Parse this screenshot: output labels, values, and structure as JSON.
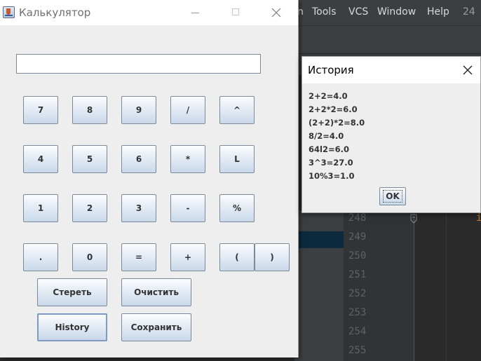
{
  "ide": {
    "menu_items": [
      "n",
      "Tools",
      "VCS",
      "Window",
      "Help",
      "24"
    ],
    "line_numbers": [
      "248",
      "249",
      "250",
      "251",
      "252",
      "253",
      "254",
      "255"
    ],
    "code_fragment": "i"
  },
  "calculator": {
    "window_title": "Калькулятор",
    "display_value": "",
    "buttons": {
      "b7": "7",
      "b8": "8",
      "b9": "9",
      "div": "/",
      "pow": "^",
      "b4": "4",
      "b5": "5",
      "b6": "6",
      "mul": "*",
      "log": "L",
      "b1": "1",
      "b2": "2",
      "b3": "3",
      "sub": "-",
      "mod": "%",
      "dot": ".",
      "b0": "0",
      "eq": "=",
      "add": "+",
      "lparen": "(",
      "rparen": ")",
      "erase": "Стереть",
      "clear": "Очистить",
      "history": "History",
      "save": "Сохранить"
    }
  },
  "history_dialog": {
    "title": "История",
    "entries": [
      "2+2=4.0",
      "2+2*2=6.0",
      "(2+2)*2=8.0",
      "8/2=4.0",
      "64l2=6.0",
      "3^3=27.0",
      "10%3=1.0"
    ],
    "ok_label": "OK"
  }
}
